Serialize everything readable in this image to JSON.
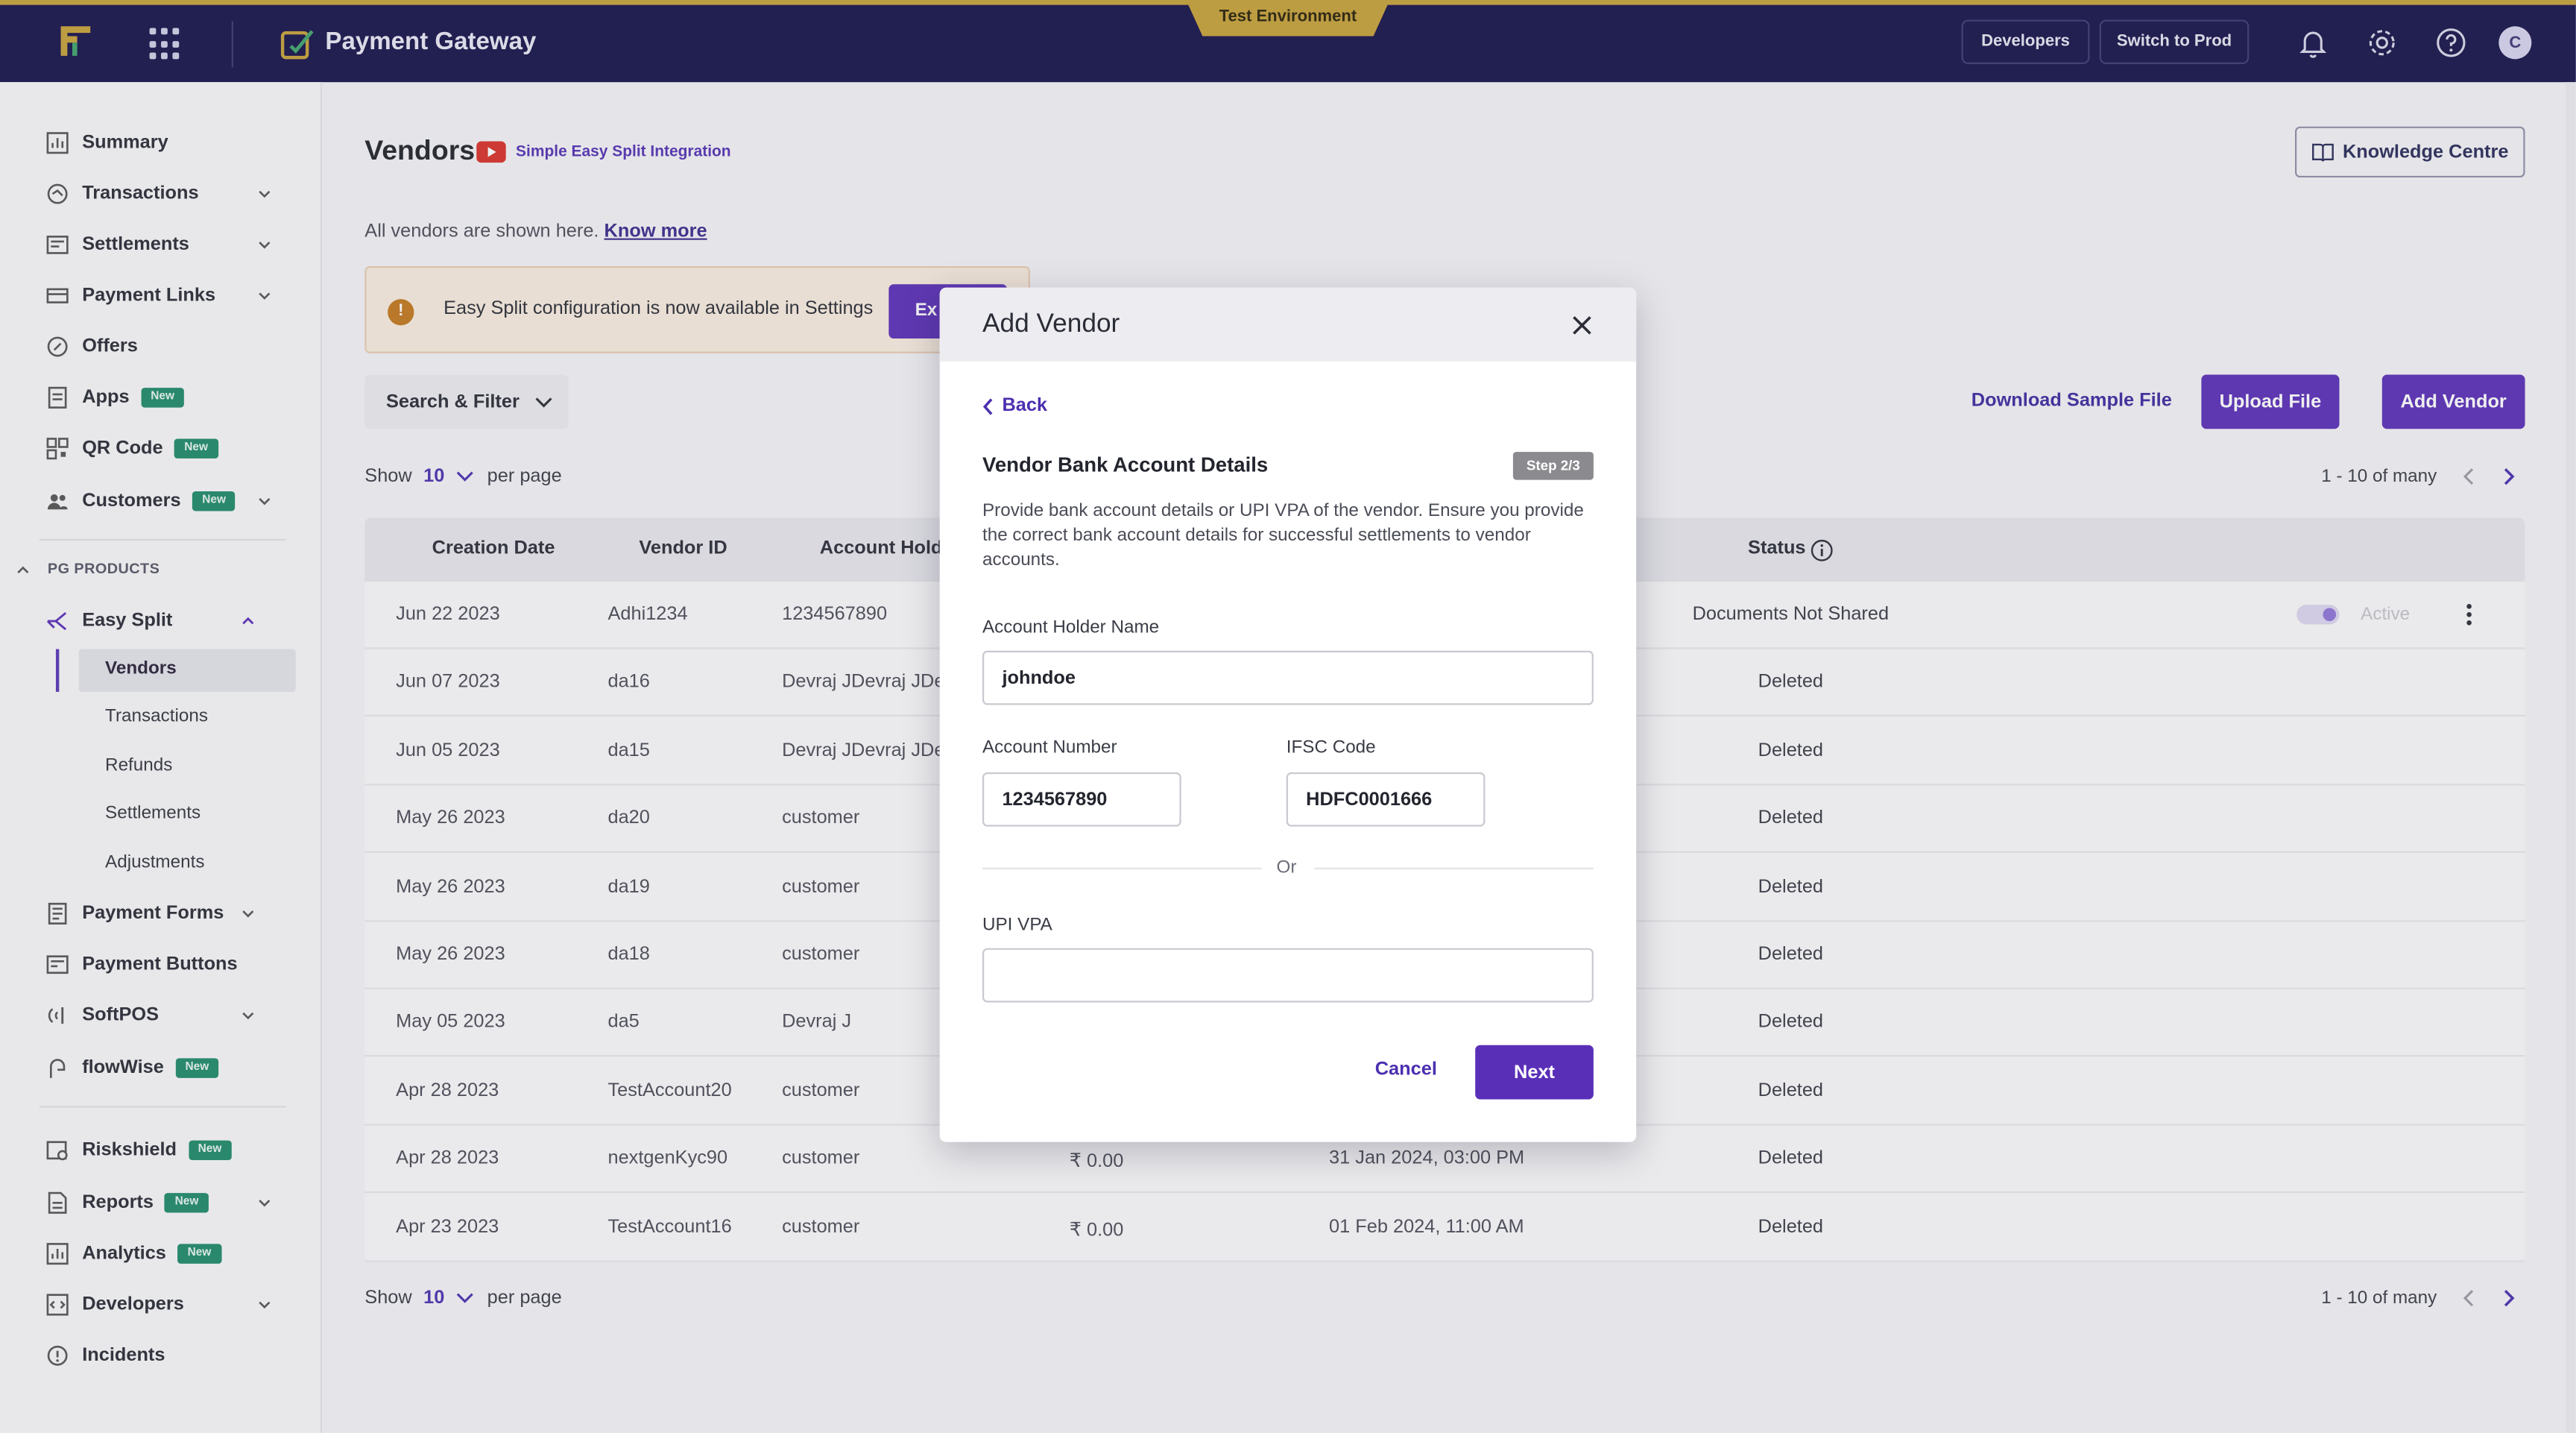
{
  "header": {
    "app_title": "Payment Gateway",
    "environment": "Test Environment",
    "developers_label": "Developers",
    "switch_label": "Switch to Prod",
    "avatar_initial": "C",
    "icons": [
      "apps-grid-icon",
      "bell-icon",
      "gear-icon",
      "help-icon"
    ]
  },
  "sidebar": {
    "items": [
      {
        "label": "Summary"
      },
      {
        "label": "Transactions"
      },
      {
        "label": "Settlements"
      },
      {
        "label": "Payment Links"
      },
      {
        "label": "Offers"
      },
      {
        "label": "Apps",
        "badge": "New"
      },
      {
        "label": "QR Code",
        "badge": "New"
      },
      {
        "label": "Customers",
        "badge": "New"
      }
    ],
    "section_label": "PG PRODUCTS",
    "easy_split": {
      "label": "Easy Split",
      "sub_items": [
        "Vendors",
        "Transactions",
        "Refunds",
        "Settlements",
        "Adjustments"
      ]
    },
    "products": [
      {
        "label": "Payment Forms"
      },
      {
        "label": "Payment Buttons"
      },
      {
        "label": "SoftPOS"
      },
      {
        "label": "flowWise",
        "badge": "New"
      }
    ],
    "bottom": [
      {
        "label": "Riskshield",
        "badge": "New"
      },
      {
        "label": "Reports",
        "badge": "New"
      },
      {
        "label": "Analytics",
        "badge": "New"
      },
      {
        "label": "Developers"
      },
      {
        "label": "Incidents"
      }
    ]
  },
  "main": {
    "title": "Vendors",
    "video_link": "Simple Easy Split Integration",
    "knowledge_centre": "Knowledge Centre",
    "description": "All vendors are shown here.",
    "know_more": "Know more",
    "banner_text": "Easy Split configuration is now available in Settings",
    "banner_button": "Ex",
    "search_filter": "Search & Filter",
    "download_sample": "Download Sample File",
    "upload_file": "Upload File",
    "add_vendor": "Add Vendor",
    "show_label": "Show",
    "per_page_value": "10",
    "per_page_label": "per page",
    "pagination": "1 - 10 of many"
  },
  "table": {
    "columns": {
      "creation_date": "Creation Date",
      "vendor_id": "Vendor ID",
      "account_holder": "Account Holde",
      "status": "Status"
    },
    "rows": [
      {
        "date": "Jun 22 2023",
        "vendor_id": "Adhi1234",
        "holder": "1234567890",
        "amount": "",
        "updated": "",
        "status": "Documents Not Shared",
        "toggle_label": "Active"
      },
      {
        "date": "Jun 07 2023",
        "vendor_id": "da16",
        "holder": "Devraj JDevraj JDe",
        "amount": "",
        "updated": "",
        "status": "Deleted"
      },
      {
        "date": "Jun 05 2023",
        "vendor_id": "da15",
        "holder": "Devraj JDevraj JDe",
        "amount": "",
        "updated": "",
        "status": "Deleted"
      },
      {
        "date": "May 26 2023",
        "vendor_id": "da20",
        "holder": "customer",
        "amount": "",
        "updated": "",
        "status": "Deleted"
      },
      {
        "date": "May 26 2023",
        "vendor_id": "da19",
        "holder": "customer",
        "amount": "",
        "updated": "",
        "status": "Deleted"
      },
      {
        "date": "May 26 2023",
        "vendor_id": "da18",
        "holder": "customer",
        "amount": "",
        "updated": "",
        "status": "Deleted"
      },
      {
        "date": "May 05 2023",
        "vendor_id": "da5",
        "holder": "Devraj J",
        "amount": "",
        "updated": "",
        "status": "Deleted"
      },
      {
        "date": "Apr 28 2023",
        "vendor_id": "TestAccount20",
        "holder": "customer",
        "amount": "",
        "updated": "",
        "status": "Deleted"
      },
      {
        "date": "Apr 28 2023",
        "vendor_id": "nextgenKyc90",
        "holder": "customer",
        "amount": "₹ 0.00",
        "updated": "31 Jan 2024, 03:00 PM",
        "status": "Deleted"
      },
      {
        "date": "Apr 23 2023",
        "vendor_id": "TestAccount16",
        "holder": "customer",
        "amount": "₹ 0.00",
        "updated": "01 Feb 2024, 11:00 AM",
        "status": "Deleted"
      }
    ]
  },
  "modal": {
    "title": "Add Vendor",
    "back": "Back",
    "section_title": "Vendor Bank Account Details",
    "step": "Step 2/3",
    "description": "Provide bank account details or UPI VPA of the vendor. Ensure you provide the correct bank account details for successful settlements to vendor accounts.",
    "account_holder_label": "Account Holder Name",
    "account_holder_value": "johndoe",
    "account_number_label": "Account Number",
    "account_number_value": "1234567890",
    "ifsc_label": "IFSC Code",
    "ifsc_value": "HDFC0001666",
    "or": "Or",
    "upi_label": "UPI VPA",
    "upi_value": "",
    "cancel": "Cancel",
    "next": "Next"
  },
  "colors": {
    "primary": "#5a2fb8",
    "topbar": "#16134a",
    "accent_gold": "#c7a23a",
    "badge_new": "#1f8a6a"
  }
}
